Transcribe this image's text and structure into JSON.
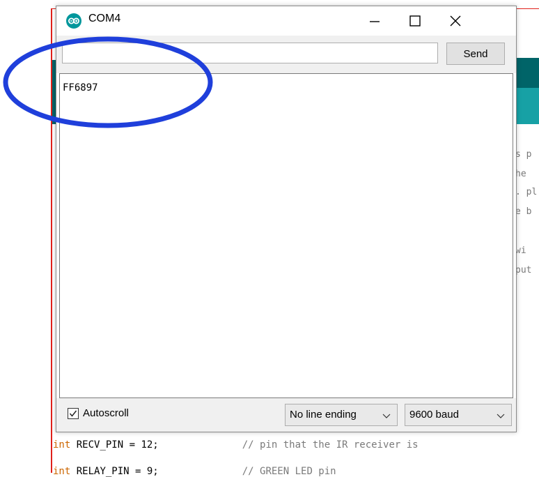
{
  "window": {
    "title": "COM4",
    "icon": "arduino-infinity-icon",
    "minimize_icon": "minimize-icon",
    "maximize_icon": "maximize-icon",
    "close_icon": "close-icon"
  },
  "input": {
    "value": "",
    "send_label": "Send"
  },
  "output": {
    "text": "FF6897"
  },
  "bottom_bar": {
    "autoscroll_label": "Autoscroll",
    "autoscroll_checked": true,
    "line_ending": "No line ending",
    "baud_rate": "9600 baud"
  },
  "ide_background": {
    "fragments": [
      "s p",
      "he ",
      ". pl",
      "e b",
      " wi",
      "put"
    ],
    "code_line_1": {
      "keyword": "int",
      "rest": " RECV_PIN = 12;",
      "comment": "// pin that the IR receiver is"
    },
    "code_line_2": {
      "keyword": "int",
      "rest": " RELAY_PIN = 9;",
      "comment": "// GREEN LED pin"
    }
  },
  "colors": {
    "accent_red_border": "#e0211b",
    "arduino_teal": "#006468",
    "arduino_teal_light": "#17a1a5",
    "annotation_blue": "#1f3fdb",
    "keyword_orange": "#cc6600"
  }
}
